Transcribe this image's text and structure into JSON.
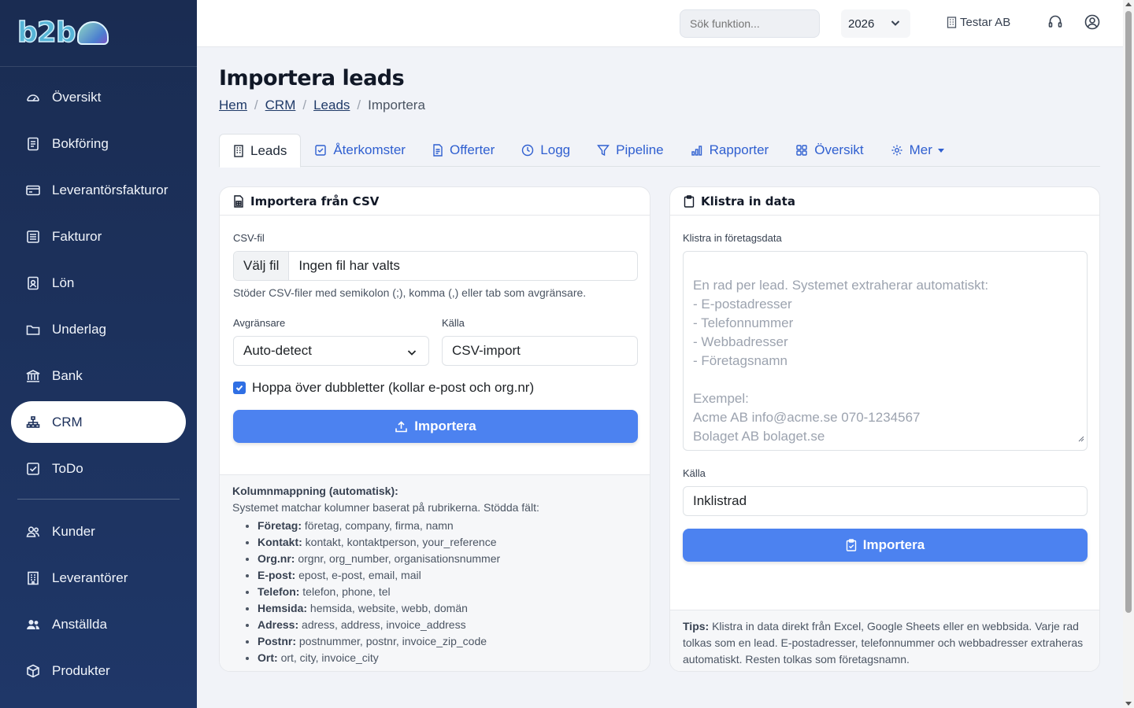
{
  "brand": {
    "logo_text": "b2b"
  },
  "sidebar": {
    "items": [
      {
        "label": "Översikt"
      },
      {
        "label": "Bokföring"
      },
      {
        "label": "Leverantörsfakturor"
      },
      {
        "label": "Fakturor"
      },
      {
        "label": "Lön"
      },
      {
        "label": "Underlag"
      },
      {
        "label": "Bank"
      },
      {
        "label": "CRM"
      },
      {
        "label": "ToDo"
      },
      {
        "label": "Kunder"
      },
      {
        "label": "Leverantörer"
      },
      {
        "label": "Anställda"
      },
      {
        "label": "Produkter"
      }
    ],
    "active": "CRM"
  },
  "topbar": {
    "search_placeholder": "Sök funktion...",
    "year": "2026",
    "company": "Testar AB"
  },
  "page": {
    "title": "Importera leads",
    "breadcrumbs": [
      "Hem",
      "CRM",
      "Leads",
      "Importera"
    ]
  },
  "tabs": [
    {
      "label": "Leads"
    },
    {
      "label": "Återkomster"
    },
    {
      "label": "Offerter"
    },
    {
      "label": "Logg"
    },
    {
      "label": "Pipeline"
    },
    {
      "label": "Rapporter"
    },
    {
      "label": "Översikt"
    },
    {
      "label": "Mer"
    }
  ],
  "csv_card": {
    "title": "Importera från CSV",
    "file_label": "CSV-fil",
    "file_button": "Välj fil",
    "file_status": "Ingen fil har valts",
    "file_help": "Stöder CSV-filer med semikolon (;), komma (,) eller tab som avgränsare.",
    "delimiter_label": "Avgränsare",
    "delimiter_value": "Auto-detect",
    "source_label": "Källa",
    "source_value": "CSV-import",
    "skip_duplicates_label": "Hoppa över dubbletter (kollar e-post och org.nr)",
    "skip_duplicates_checked": true,
    "import_button": "Importera",
    "mapping_title": "Kolumnmappning (automatisk):",
    "mapping_intro": "Systemet matchar kolumner baserat på rubrikerna. Stödda fält:",
    "mapping": [
      {
        "field": "Företag:",
        "aliases": "företag, company, firma, namn"
      },
      {
        "field": "Kontakt:",
        "aliases": "kontakt, kontaktperson, your_reference"
      },
      {
        "field": "Org.nr:",
        "aliases": "orgnr, org_number, organisationsnummer"
      },
      {
        "field": "E-post:",
        "aliases": "epost, e-post, email, mail"
      },
      {
        "field": "Telefon:",
        "aliases": "telefon, phone, tel"
      },
      {
        "field": "Hemsida:",
        "aliases": "hemsida, website, webb, domän"
      },
      {
        "field": "Adress:",
        "aliases": "adress, address, invoice_address"
      },
      {
        "field": "Postnr:",
        "aliases": "postnummer, postnr, invoice_zip_code"
      },
      {
        "field": "Ort:",
        "aliases": "ort, city, invoice_city"
      }
    ]
  },
  "paste_card": {
    "title": "Klistra in data",
    "data_label": "Klistra in företagsdata",
    "placeholder": "En rad per lead. Systemet extraherar automatiskt:\n- E-postadresser\n- Telefonnummer\n- Webbadresser\n- Företagsnamn\n\nExempel:\nAcme AB info@acme.se 070-1234567\nBolaget AB bolaget.se",
    "source_label": "Källa",
    "source_value": "Inklistrad",
    "import_button": "Importera",
    "tip_title": "Tips:",
    "tip_text": "Klistra in data direkt från Excel, Google Sheets eller en webbsida. Varje rad tolkas som en lead. E-postadresser, telefonnummer och webbadresser extraheras automatiskt. Resten tolkas som företagsnamn."
  },
  "colors": {
    "sidebar": "#1f3768",
    "accent": "#4c82f0",
    "link": "#2f5fd0"
  }
}
